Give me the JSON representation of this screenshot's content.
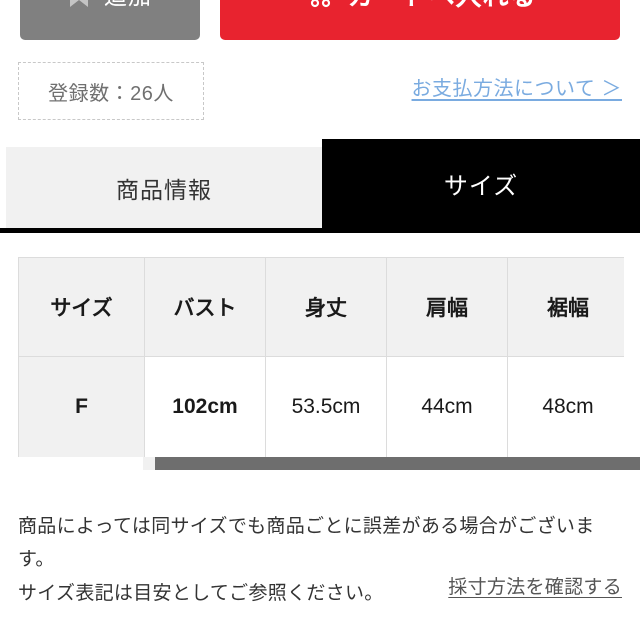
{
  "actions": {
    "favorite_button": {
      "label": "追加",
      "icon": "bookmark-icon",
      "bg_color": "#808080"
    },
    "cart_button": {
      "label": "カートへ入れる",
      "icon": "cart-icon",
      "bg_color": "#e8232f"
    }
  },
  "info": {
    "registration_count": "登録数：26人",
    "payment_link": "お支払方法について ＞",
    "payment_link_color": "#7aabe0"
  },
  "tabs": [
    {
      "label": "商品情報",
      "active": false
    },
    {
      "label": "サイズ",
      "active": true
    }
  ],
  "size_table": {
    "headers": [
      "サイズ",
      "バスト",
      "身丈",
      "肩幅",
      "裾幅"
    ],
    "rows": [
      {
        "size": "F",
        "bust": "102cm",
        "length": "53.5cm",
        "shoulder": "44cm",
        "hem": "48cm"
      }
    ]
  },
  "notes": {
    "line1": "商品によっては同サイズでも商品ごとに誤差がある場合がございます。",
    "line2": "サイズ表記は目安としてご参照ください。",
    "measure_link": "採寸方法を確認する"
  }
}
